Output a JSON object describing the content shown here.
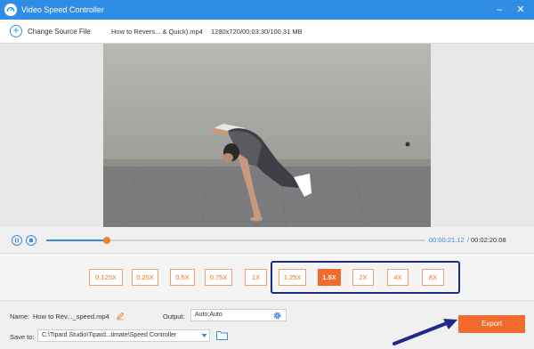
{
  "window": {
    "title": "Video Speed Controller",
    "minimize": "–",
    "close": "✕",
    "accent": "#2f8de4"
  },
  "source": {
    "change_label": "Change Source File",
    "file_name": "How to Revers... & Quick).mp4",
    "file_info": "1280x720/00:03:30/100.31 MB"
  },
  "player": {
    "progress": 0.16,
    "current_time": "00:00:21.12",
    "separator": "/",
    "total_time": "00:02:20.08"
  },
  "speeds": {
    "options": [
      "0.125X",
      "0.25X",
      "0.5X",
      "0.75X",
      "1X",
      "1.25X",
      "1.5X",
      "2X",
      "4X",
      "8X"
    ],
    "selected": "1.5X",
    "active_color": "#f26b2c"
  },
  "bottom": {
    "name_label": "Name:",
    "name_value": "How to Rev..._speed.mp4",
    "output_label": "Output:",
    "output_value": "Auto;Auto",
    "save_label": "Save to:",
    "save_path": "C:\\Tipard Studio\\Tipard...timate\\Speed Controller",
    "export_label": "Export"
  }
}
